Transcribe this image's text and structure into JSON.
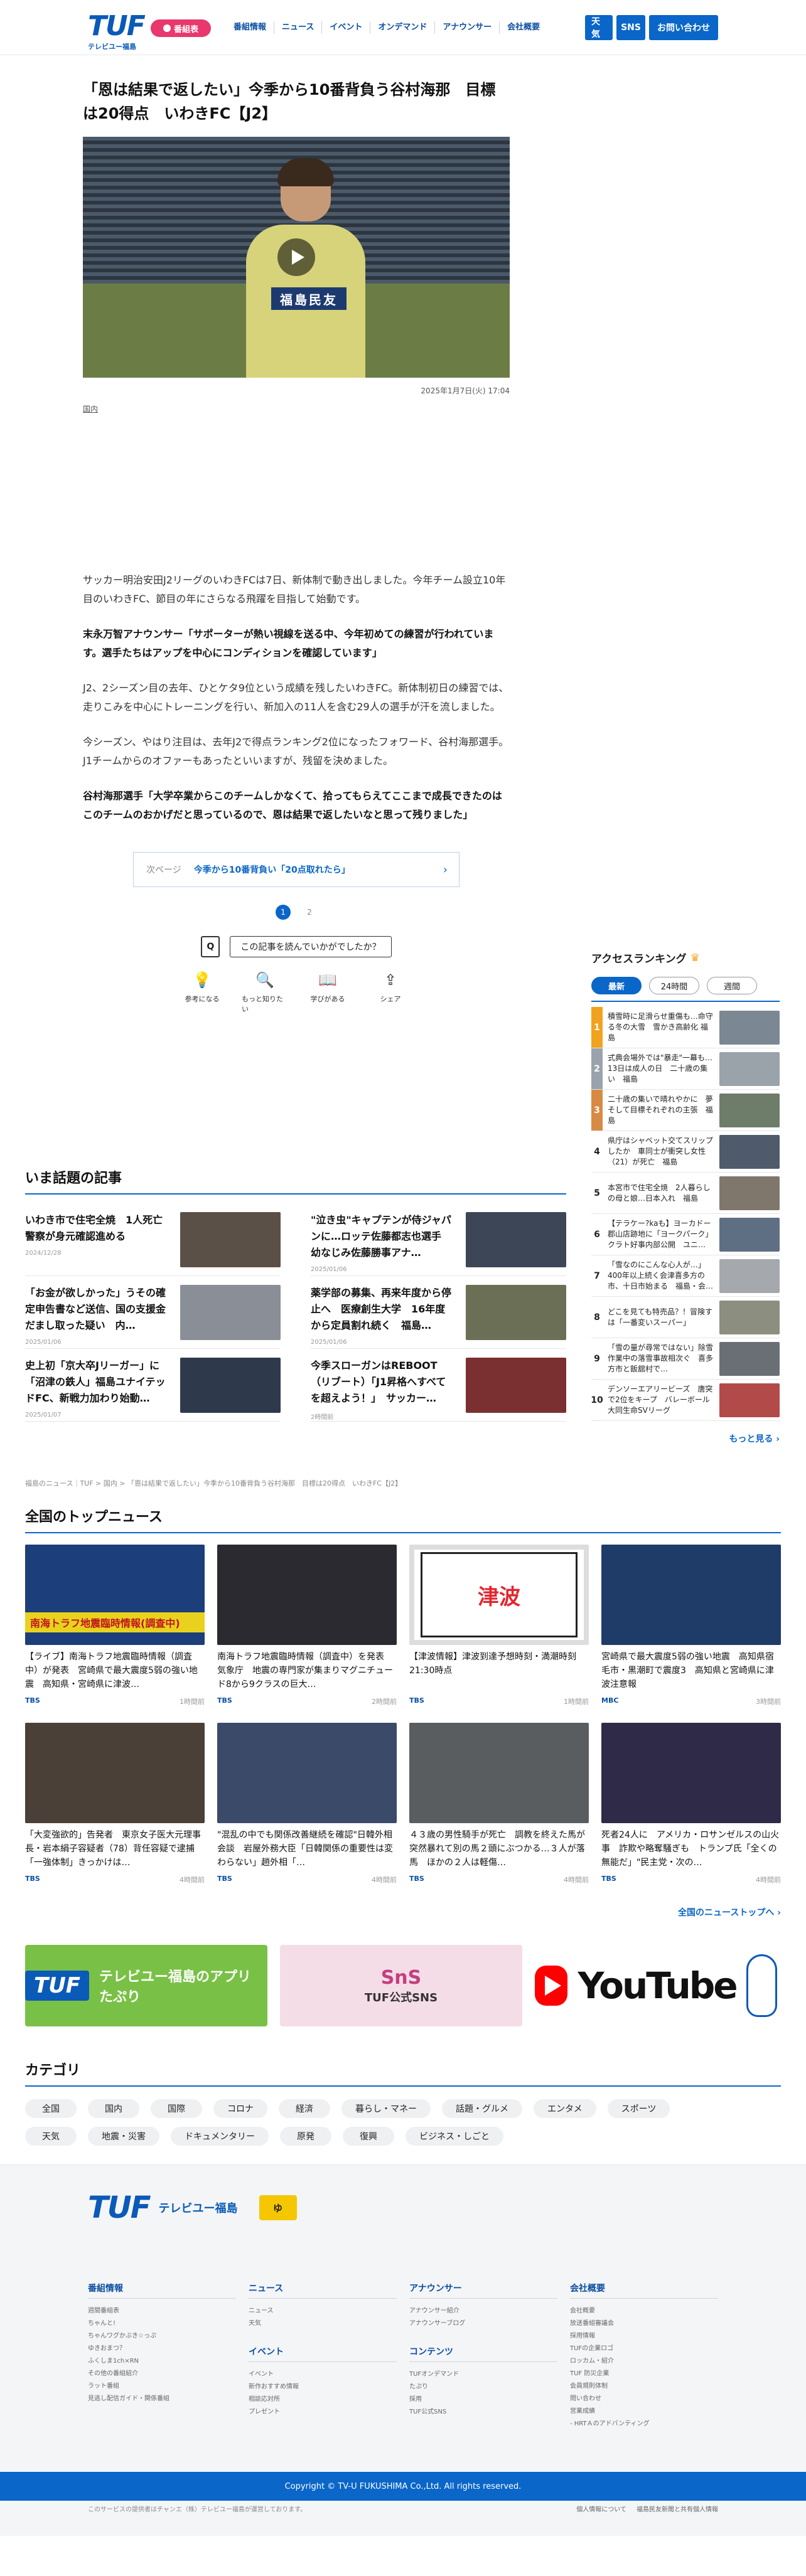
{
  "header": {
    "logo_text": "TUF",
    "logo_sub": "テレビユー福島",
    "bangumi_label": "番組表",
    "nav": [
      "番組情報",
      "ニュース",
      "イベント",
      "オンデマンド",
      "アナウンサー",
      "会社概要"
    ],
    "buttons": [
      "天気",
      "SNS",
      "お問い合わせ"
    ]
  },
  "article": {
    "title": "「恩は結果で返したい」今季から10番背負う谷村海那　目標は20得点　いわきFC【J2】",
    "video_caption": "福島民友",
    "date": "2025年1月7日(火) 17:04",
    "category": "国内",
    "paragraphs": [
      {
        "text": "サッカー明治安田J2リーグのいわきFCは7日、新体制で動き出しました。今年チーム設立10年目のいわきFC、節目の年にさらなる飛躍を目指して始動です。",
        "bold": false
      },
      {
        "text": "末永万智アナウンサー「サポーターが熱い視線を送る中、今年初めての練習が行われています。選手たちはアップを中心にコンディションを確認しています」",
        "bold": true
      },
      {
        "text": "J2、2シーズン目の去年、ひとケタ9位という成績を残したいわきFC。新体制初日の練習では、走りこみを中心にトレーニングを行い、新加入の11人を含む29人の選手が汗を流しました。",
        "bold": false
      },
      {
        "text": "今シーズン、やはり注目は、去年J2で得点ランキング2位になったフォワード、谷村海那選手。J1チームからのオファーもあったといいますが、残留を決めました。",
        "bold": false
      },
      {
        "text": "谷村海那選手「大学卒業からこのチームしかなくて、拾ってもらえてここまで成長できたのはこのチームのおかげだと思っているので、恩は結果で返したいなと思って残りました」",
        "bold": true
      }
    ],
    "next_label": "次ページ",
    "next_title": "今季から10番背負い「20点取れたら」",
    "next_arrow": "›",
    "pages": [
      "1",
      "2"
    ],
    "survey_icon": "Q",
    "survey_question": "この記事を読んでいかがでしたか？",
    "reactions": [
      {
        "icon": "lightbulb-icon",
        "glyph": "💡",
        "label": "参考になる"
      },
      {
        "icon": "search-icon",
        "glyph": "🔍",
        "label": "もっと知りたい"
      },
      {
        "icon": "book-icon",
        "glyph": "📖",
        "label": "学びがある"
      },
      {
        "icon": "share-icon",
        "glyph": "⇪",
        "label": "シェア"
      }
    ]
  },
  "ranking": {
    "title": "アクセスランキング",
    "crown_glyph": "♛",
    "tabs": [
      "最新",
      "24時間",
      "週間"
    ],
    "items": [
      {
        "num": "1",
        "text": "積雪時に足滑らせ重傷も…命守る冬の大雪　雪かき高齢化 福島",
        "color": "#f1a31f"
      },
      {
        "num": "2",
        "text": "式典会場外では\"暴走\"一幕も…13日は成人の日　二十歳の集い　福島",
        "color": "#9aa3ad"
      },
      {
        "num": "3",
        "text": "二十歳の集いで晴れやかに　夢そして目標それぞれの主張　福島",
        "color": "#d88a45"
      },
      {
        "num": "4",
        "text": "県庁はシャベット交てスリップしたか　車同士が衝突し女性（21）が死亡　福島",
        "color": ""
      },
      {
        "num": "5",
        "text": "本宮市で住宅全焼　2人暮らしの母と娘…日本入れ　福島",
        "color": ""
      },
      {
        "num": "6",
        "text": "【テラケー?kaも】ヨーカドー郡山店跡地に「ヨークパーク」クラト好事内部公開　ユニ…",
        "color": ""
      },
      {
        "num": "7",
        "text": "「雪なのにこんな心人が…」400年以上続く会津喜多方の市、十日市始まる　福島・会…",
        "color": ""
      },
      {
        "num": "8",
        "text": "どこを見ても特売品？！冒険すは「一番変いスーパー」",
        "color": ""
      },
      {
        "num": "9",
        "text": "「雪の量が尋常ではない」除雪作業中の落雪事故相次ぐ　喜多方市と飯舘村で…",
        "color": ""
      },
      {
        "num": "10",
        "text": "デンソーエアリービーズ　唐突で2位をキープ　バレーボール大同生命SVリーグ",
        "color": ""
      }
    ],
    "more": "もっと見る ›"
  },
  "trending": {
    "title": "いま話題の記事",
    "items": [
      {
        "title": "いわき市で住宅全焼　1人死亡　警察が身元確認進める",
        "date": "2024/12/28"
      },
      {
        "title": "\"泣き虫\"キャプテンが侍ジャパンに…ロッテ佐藤都志也選手　幼なじみ佐藤勝事アナ…",
        "date": "2025/01/06"
      },
      {
        "title": "「お金が欲しかった」うその確定申告書など送信、国の支援金だまし取った疑い　内…",
        "date": "2025/01/06"
      },
      {
        "title": "薬学部の募集、再来年度から停止へ　医療創生大学　16年度から定員割れ続く　福島…",
        "date": "2025/01/06"
      },
      {
        "title": "史上初「京大卒Jリーガー」に「沼津の鉄人」福島ユナイテッドFC、新戦力加わり始動…",
        "date": "2025/01/07"
      },
      {
        "title": "今季スローガンはREBOOT（リブート）「J1昇格へすべてを超えよう！」　サッカー…",
        "date": "2時間前"
      }
    ]
  },
  "breadcrumb": "福島のニュース｜TUF > 国内 > 「恩は結果で返したい」今季から10番背負う谷村海那　目標は20得点　いわきFC【J2】",
  "national": {
    "title": "全国のトップニュース",
    "items": [
      {
        "title": "【ライブ】南海トラフ地震臨時情報（調査中）が発表　宮崎県で最大震度5弱の強い地震　高知県・宮崎県に津波…",
        "source": "TBS",
        "date": "1時間前",
        "img": "#1c3e7a",
        "overlay": "南海トラフ地震臨時情報(調査中)"
      },
      {
        "title": "南海トラフ地震臨時情報（調査中）を発表　気象庁　地震の専門家が集まりマグニチュード8から9クラスの巨大…",
        "source": "TBS",
        "date": "2時間前",
        "img": "#2b2a30",
        "overlay": ""
      },
      {
        "title": "【津波情報】津波到達予想時刻・満潮時刻 21:30時点",
        "source": "TBS",
        "date": "1時間前",
        "img": "tsunami",
        "overlay": "津波"
      },
      {
        "title": "宮崎県で最大震度5弱の強い地震　高知県宿毛市・黒潮町で震度3　高知県と宮崎県に津波注意報",
        "source": "MBC",
        "date": "3時間前",
        "img": "#1f3b68",
        "overlay": ""
      },
      {
        "title": "「大変強欲的」告発者　東京女子医大元理事長・岩本絹子容疑者（78）背任容疑で逮捕「一強体制」きっかけは…",
        "source": "TBS",
        "date": "4時間前",
        "img": "#4a4038",
        "overlay": ""
      },
      {
        "title": "\"混乱の中でも関係改善継続を確認\"日韓外相会談　岩屋外務大臣「日韓関係の重要性は変わらない」趙外相「…",
        "source": "TBS",
        "date": "4時間前",
        "img": "#3b4a68",
        "overlay": ""
      },
      {
        "title": "４３歳の男性騎手が死亡　調教を終えた馬が突然暴れて別の馬２頭にぶつかる…３人が落馬　ほかの２人は軽傷…",
        "source": "TBS",
        "date": "4時間前",
        "img": "#5a5d60",
        "overlay": ""
      },
      {
        "title": "死者24人に　アメリカ・ロサンゼルスの山火事　詐欺や略奪騒ぎも　トランプ氏「全くの無能だ」\"民主党・次の…",
        "source": "TBS",
        "date": "4時間前",
        "img": "#2e2a48",
        "overlay": ""
      }
    ],
    "more": "全国のニューストップへ ›"
  },
  "banners": {
    "app_logo": "TUF",
    "app_title": "テレビユー福島のアプリ たぷり",
    "sns_title": "SnS",
    "sns_sub": "TUF公式SNS",
    "youtube_word": "YouTube"
  },
  "categories": {
    "title": "カテゴリ",
    "items": [
      "全国",
      "国内",
      "国際",
      "コロナ",
      "経済",
      "暮らし・マネー",
      "話題・グルメ",
      "エンタメ",
      "スポーツ",
      "天気",
      "地震・災害",
      "ドキュメンタリー",
      "原発",
      "復興",
      "ビジネス・しごと"
    ]
  },
  "footer": {
    "logo": "TUF",
    "logo_sub": "テレビユー福島",
    "mascot": "ゆ",
    "columns": [
      {
        "groups": [
          {
            "head": "番組情報",
            "links": [
              "週間番組表",
              "ちゃんと!",
              "ちゃんワグかぶき☆っぷ",
              "ゆきおまつ？",
              "ふくしま1ch×RN",
              "その他の番組紹介",
              "ラット番組",
              "見逃し配信ガイド・関係番組"
            ]
          }
        ]
      },
      {
        "groups": [
          {
            "head": "ニュース",
            "links": [
              "ニュース",
              "天気"
            ]
          },
          {
            "head": "イベント",
            "links": [
              "イベント",
              "新作おすすめ情報",
              "相談応対所",
              "プレゼント"
            ]
          }
        ]
      },
      {
        "groups": [
          {
            "head": "アナウンサー",
            "links": [
              "アナウンサー紹介",
              "アナウンサーブログ"
            ]
          },
          {
            "head": "コンテンツ",
            "links": [
              "TUFオンデマンド",
              "たぷり",
              "採用",
              "TUF公式SNS"
            ]
          }
        ]
      },
      {
        "groups": [
          {
            "head": "会社概要",
            "links": [
              "会社概要",
              "放送番組審議会",
              "採用情報",
              "TUFの企業ロゴ",
              "ロッカム・紹介",
              "TUF 防災企業",
              "会員規則体制",
              "問い合わせ",
              "営業成績",
              "- HRTＡのアドバンティング"
            ]
          }
        ]
      }
    ],
    "note": "このサービスの提供者はチャンエ（株）テレビユー福島が運営しております。",
    "links": [
      "個人情報について",
      "福島民友新聞と共有個人情報"
    ],
    "copyright": "Copyright © TV-U FUKUSHIMA Co.,Ltd. All rights reserved."
  }
}
